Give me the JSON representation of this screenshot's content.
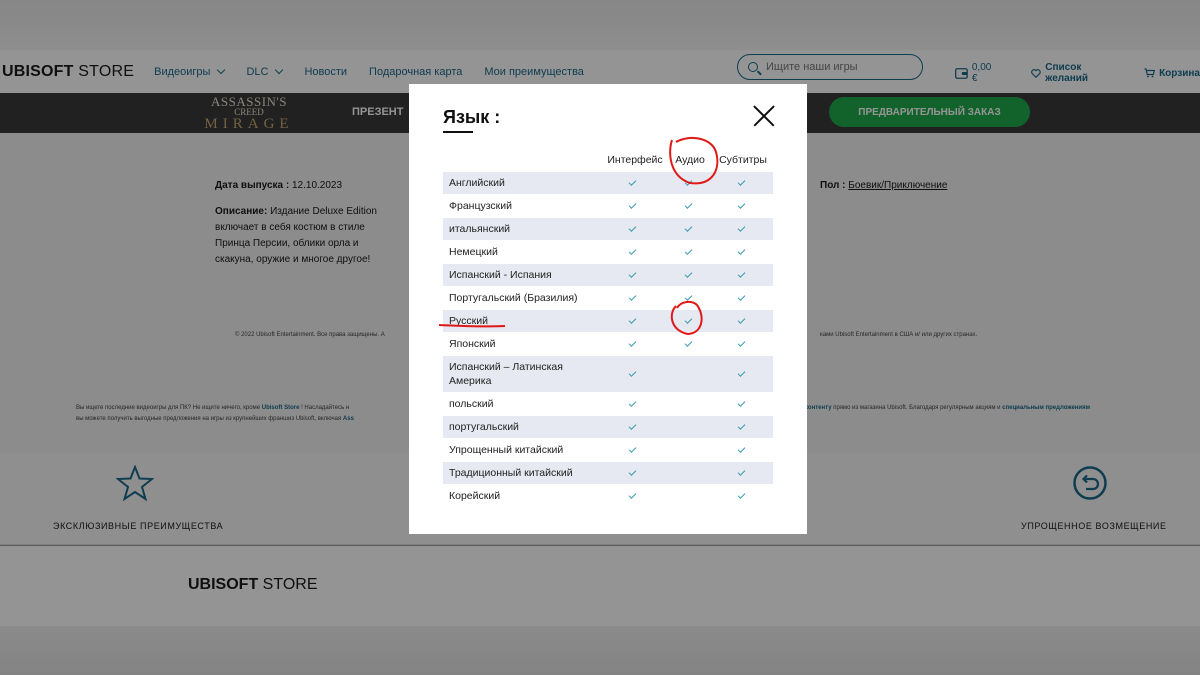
{
  "nav": {
    "logo_bold": "UBISOFT",
    "logo_light": "STORE",
    "links": [
      "Видеоигры",
      "DLC",
      "Новости",
      "Подарочная карта",
      "Мои преимущества"
    ],
    "search_placeholder": "Ищите наши игры",
    "cart_amount": "0,00 €",
    "wishlist": "Список желаний",
    "basket": "Корзина"
  },
  "gamebar": {
    "logo_line1": "ASSASSIN'S",
    "logo_line2": "CREED",
    "logo_line3": "MIRAGE",
    "present_label": "ПРЕЗЕНТ",
    "preorder_label": "ПРЕДВАРИТЕЛЬНЫЙ ЗАКАЗ"
  },
  "details": {
    "release_label": "Дата выпуска :",
    "release_value": "12.10.2023",
    "desc_label": "Описание:",
    "desc_text": "Издание Deluxe Edition включает в себя костюм в стиле Принца Персии, облики орла и скакуна, оружие и многое другое!",
    "genre_label": "Пол :",
    "genre_value": "Боевик/Приключение",
    "copyright_left": "© 2022 Ubisoft Entertainment. Все права защищены. A",
    "copyright_right": "ками Ubisoft Entertainment в США и/ или других странах.",
    "seo_left_1": "Вы ищете последние видеоигры для ПК? Не ищите ничего, кроме",
    "seo_left_link": "Ubisoft Store",
    "seo_left_2": "! Насладайтесь н",
    "seo_left_line2": "вы можете получить выгодные предложения на игры из крупнейших франшиз Ubisoft, включая",
    "seo_left_line2_link": "Ass",
    "seo_right_link1": "контенту",
    "seo_right_text": "прямо из магазина Ubisoft. Благодаря регулярным акциям и",
    "seo_right_link2": "специальным предложениям"
  },
  "features": {
    "left_label": "ЭКСКЛЮЗИВНЫЕ ПРЕИМУЩЕСТВА",
    "right_label": "УПРОЩЕННОЕ ВОЗМЕЩЕНИЕ"
  },
  "footer": {
    "logo_bold": "UBISOFT",
    "logo_light": "STORE"
  },
  "modal": {
    "title": "Язык :",
    "columns": [
      "Интерфейс",
      "Аудио",
      "Субтитры"
    ],
    "rows": [
      {
        "name": "Английский",
        "interface": true,
        "audio": true,
        "subtitles": true
      },
      {
        "name": "Французский",
        "interface": true,
        "audio": true,
        "subtitles": true
      },
      {
        "name": "итальянский",
        "interface": true,
        "audio": true,
        "subtitles": true
      },
      {
        "name": "Немецкий",
        "interface": true,
        "audio": true,
        "subtitles": true
      },
      {
        "name": "Испанский - Испания",
        "interface": true,
        "audio": true,
        "subtitles": true
      },
      {
        "name": "Португальский (Бразилия)",
        "interface": true,
        "audio": true,
        "subtitles": true
      },
      {
        "name": "Русский",
        "interface": true,
        "audio": true,
        "subtitles": true
      },
      {
        "name": "Японский",
        "interface": true,
        "audio": true,
        "subtitles": true
      },
      {
        "name": "Испанский – Латинская Америка",
        "interface": true,
        "audio": false,
        "subtitles": true
      },
      {
        "name": "польский",
        "interface": true,
        "audio": false,
        "subtitles": true
      },
      {
        "name": "португальский",
        "interface": true,
        "audio": false,
        "subtitles": true
      },
      {
        "name": "Упрощенный китайский",
        "interface": true,
        "audio": false,
        "subtitles": true
      },
      {
        "name": "Традиционный китайский",
        "interface": true,
        "audio": false,
        "subtitles": true
      },
      {
        "name": "Корейский",
        "interface": true,
        "audio": false,
        "subtitles": true
      }
    ]
  },
  "colors": {
    "accent": "#1b6a8a",
    "preorder": "#1faa4d",
    "check": "#3a9ab0",
    "row_shade": "#e6e9f1",
    "annotation": "#e01818"
  }
}
